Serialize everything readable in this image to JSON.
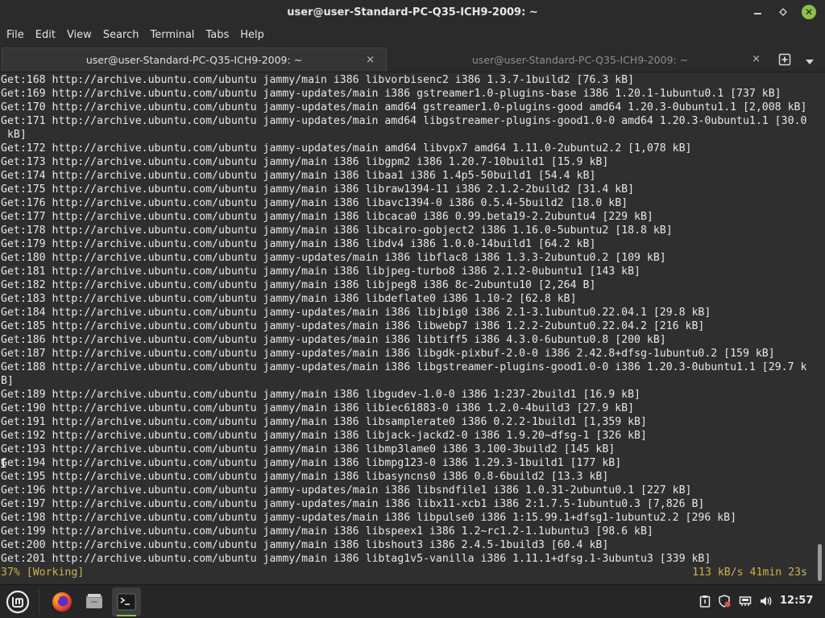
{
  "window": {
    "title": "user@user-Standard-PC-Q35-ICH9-2009: ~",
    "controls": {
      "minimize": "minimize",
      "maximize": "maximize",
      "close": "close"
    }
  },
  "menubar": {
    "items": [
      "File",
      "Edit",
      "View",
      "Search",
      "Terminal",
      "Tabs",
      "Help"
    ]
  },
  "tabs": [
    {
      "label": "user@user-Standard-PC-Q35-ICH9-2009: ~",
      "active": true,
      "close": "×"
    },
    {
      "label": "user@user-Standard-PC-Q35-ICH9-2009: ~",
      "active": false,
      "close": "×"
    }
  ],
  "terminal": {
    "lines": [
      "Get:168 http://archive.ubuntu.com/ubuntu jammy/main i386 libvorbisenc2 i386 1.3.7-1build2 [76.3 kB]",
      "Get:169 http://archive.ubuntu.com/ubuntu jammy-updates/main i386 gstreamer1.0-plugins-base i386 1.20.1-1ubuntu0.1 [737 kB]",
      "Get:170 http://archive.ubuntu.com/ubuntu jammy-updates/main amd64 gstreamer1.0-plugins-good amd64 1.20.3-0ubuntu1.1 [2,008 kB]",
      "Get:171 http://archive.ubuntu.com/ubuntu jammy-updates/main amd64 libgstreamer-plugins-good1.0-0 amd64 1.20.3-0ubuntu1.1 [30.0",
      " kB]",
      "Get:172 http://archive.ubuntu.com/ubuntu jammy-updates/main amd64 libvpx7 amd64 1.11.0-2ubuntu2.2 [1,078 kB]",
      "Get:173 http://archive.ubuntu.com/ubuntu jammy/main i386 libgpm2 i386 1.20.7-10build1 [15.9 kB]",
      "Get:174 http://archive.ubuntu.com/ubuntu jammy/main i386 libaa1 i386 1.4p5-50build1 [54.4 kB]",
      "Get:175 http://archive.ubuntu.com/ubuntu jammy/main i386 libraw1394-11 i386 2.1.2-2build2 [31.4 kB]",
      "Get:176 http://archive.ubuntu.com/ubuntu jammy/main i386 libavc1394-0 i386 0.5.4-5build2 [18.0 kB]",
      "Get:177 http://archive.ubuntu.com/ubuntu jammy/main i386 libcaca0 i386 0.99.beta19-2.2ubuntu4 [229 kB]",
      "Get:178 http://archive.ubuntu.com/ubuntu jammy/main i386 libcairo-gobject2 i386 1.16.0-5ubuntu2 [18.8 kB]",
      "Get:179 http://archive.ubuntu.com/ubuntu jammy/main i386 libdv4 i386 1.0.0-14build1 [64.2 kB]",
      "Get:180 http://archive.ubuntu.com/ubuntu jammy-updates/main i386 libflac8 i386 1.3.3-2ubuntu0.2 [109 kB]",
      "Get:181 http://archive.ubuntu.com/ubuntu jammy/main i386 libjpeg-turbo8 i386 2.1.2-0ubuntu1 [143 kB]",
      "Get:182 http://archive.ubuntu.com/ubuntu jammy/main i386 libjpeg8 i386 8c-2ubuntu10 [2,264 B]",
      "Get:183 http://archive.ubuntu.com/ubuntu jammy/main i386 libdeflate0 i386 1.10-2 [62.8 kB]",
      "Get:184 http://archive.ubuntu.com/ubuntu jammy-updates/main i386 libjbig0 i386 2.1-3.1ubuntu0.22.04.1 [29.8 kB]",
      "Get:185 http://archive.ubuntu.com/ubuntu jammy-updates/main i386 libwebp7 i386 1.2.2-2ubuntu0.22.04.2 [216 kB]",
      "Get:186 http://archive.ubuntu.com/ubuntu jammy-updates/main i386 libtiff5 i386 4.3.0-6ubuntu0.8 [200 kB]",
      "Get:187 http://archive.ubuntu.com/ubuntu jammy-updates/main i386 libgdk-pixbuf-2.0-0 i386 2.42.8+dfsg-1ubuntu0.2 [159 kB]",
      "Get:188 http://archive.ubuntu.com/ubuntu jammy-updates/main i386 libgstreamer-plugins-good1.0-0 i386 1.20.3-0ubuntu1.1 [29.7 k",
      "B]",
      "Get:189 http://archive.ubuntu.com/ubuntu jammy/main i386 libgudev-1.0-0 i386 1:237-2build1 [16.9 kB]",
      "Get:190 http://archive.ubuntu.com/ubuntu jammy/main i386 libiec61883-0 i386 1.2.0-4build3 [27.9 kB]",
      "Get:191 http://archive.ubuntu.com/ubuntu jammy/main i386 libsamplerate0 i386 0.2.2-1build1 [1,359 kB]",
      "Get:192 http://archive.ubuntu.com/ubuntu jammy/main i386 libjack-jackd2-0 i386 1.9.20~dfsg-1 [326 kB]",
      "Get:193 http://archive.ubuntu.com/ubuntu jammy/main i386 libmp3lame0 i386 3.100-3build2 [145 kB]",
      "Get:194 http://archive.ubuntu.com/ubuntu jammy/main i386 libmpg123-0 i386 1.29.3-1build1 [177 kB]",
      "Get:195 http://archive.ubuntu.com/ubuntu jammy/main i386 libasyncns0 i386 0.8-6build2 [13.3 kB]",
      "Get:196 http://archive.ubuntu.com/ubuntu jammy-updates/main i386 libsndfile1 i386 1.0.31-2ubuntu0.1 [227 kB]",
      "Get:197 http://archive.ubuntu.com/ubuntu jammy-updates/main i386 libx11-xcb1 i386 2:1.7.5-1ubuntu0.3 [7,826 B]",
      "Get:198 http://archive.ubuntu.com/ubuntu jammy-updates/main i386 libpulse0 i386 1:15.99.1+dfsg1-1ubuntu2.2 [296 kB]",
      "Get:199 http://archive.ubuntu.com/ubuntu jammy/main i386 libspeex1 i386 1.2~rc1.2-1.1ubuntu3 [98.6 kB]",
      "Get:200 http://archive.ubuntu.com/ubuntu jammy/main i386 libshout3 i386 2.4.5-1build3 [60.4 kB]",
      "Get:201 http://archive.ubuntu.com/ubuntu jammy/main i386 libtag1v5-vanilla i386 1.11.1+dfsg.1-3ubuntu3 [339 kB]"
    ],
    "status_left": "37% [Working]",
    "status_right": "113 kB/s 41min 23s",
    "status_color": "#c9b34a"
  },
  "taskbar": {
    "apps": [
      {
        "name": "menu",
        "icon": "linux-mint-logo-icon"
      },
      {
        "name": "firefox",
        "icon": "firefox-icon"
      },
      {
        "name": "files",
        "icon": "files-folder-icon"
      },
      {
        "name": "terminal",
        "icon": "terminal-icon",
        "active": true
      }
    ],
    "tray": [
      "clipboard-icon",
      "shield-update-icon",
      "network-icon",
      "volume-icon"
    ],
    "clock": "12:57"
  },
  "colors": {
    "accent": "#8fc04a",
    "terminal_bg": "#2f2f2f",
    "terminal_fg": "#e8e8e8"
  }
}
